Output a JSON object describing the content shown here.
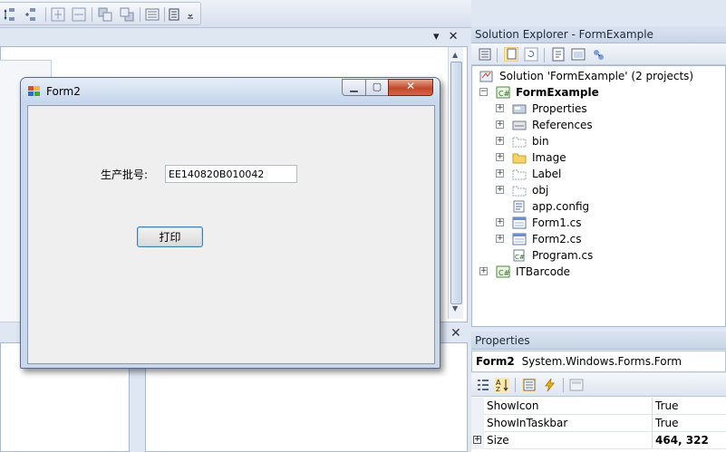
{
  "form_window": {
    "title": "Form2",
    "batch_label": "生产批号:",
    "batch_value": "EE140820B010042",
    "print_button": "打印"
  },
  "solution_explorer": {
    "title": "Solution Explorer - FormExample",
    "tree": [
      {
        "label": "Solution 'FormExample' (2 projects)",
        "icon": "solution-icon",
        "level": 0,
        "expander": "none",
        "bold": false
      },
      {
        "label": "FormExample",
        "icon": "csharp-project-icon",
        "level": 1,
        "expander": "minus",
        "bold": true
      },
      {
        "label": "Properties",
        "icon": "properties-icon",
        "level": 2,
        "expander": "plus",
        "bold": false
      },
      {
        "label": "References",
        "icon": "references-icon",
        "level": 2,
        "expander": "plus",
        "bold": false
      },
      {
        "label": "bin",
        "icon": "folder-dashed-icon",
        "level": 2,
        "expander": "plus",
        "bold": false
      },
      {
        "label": "Image",
        "icon": "folder-icon",
        "level": 2,
        "expander": "plus",
        "bold": false
      },
      {
        "label": "Label",
        "icon": "folder-dashed-icon",
        "level": 2,
        "expander": "plus",
        "bold": false
      },
      {
        "label": "obj",
        "icon": "folder-dashed-icon",
        "level": 2,
        "expander": "plus",
        "bold": false
      },
      {
        "label": "app.config",
        "icon": "config-file-icon",
        "level": 2,
        "expander": "none",
        "bold": false
      },
      {
        "label": "Form1.cs",
        "icon": "form-file-icon",
        "level": 2,
        "expander": "plus",
        "bold": false
      },
      {
        "label": "Form2.cs",
        "icon": "form-file-icon",
        "level": 2,
        "expander": "plus",
        "bold": false
      },
      {
        "label": "Program.cs",
        "icon": "csharp-file-icon",
        "level": 2,
        "expander": "none",
        "bold": false
      },
      {
        "label": "ITBarcode",
        "icon": "csharp-project-icon",
        "level": 1,
        "expander": "plus",
        "bold": false
      }
    ]
  },
  "properties": {
    "title": "Properties",
    "object_name": "Form2",
    "object_type": "System.Windows.Forms.Form",
    "rows": [
      {
        "name": "ShowIcon",
        "value": "True",
        "expandable": false,
        "bold": false
      },
      {
        "name": "ShowInTaskbar",
        "value": "True",
        "expandable": false,
        "bold": false
      },
      {
        "name": "Size",
        "value": "464, 322",
        "expandable": true,
        "bold": true
      }
    ]
  },
  "colors": {
    "ide_background": "#dfe7f2",
    "selection_accent": "#3c7fb1",
    "close_button": "#c24a2c"
  }
}
